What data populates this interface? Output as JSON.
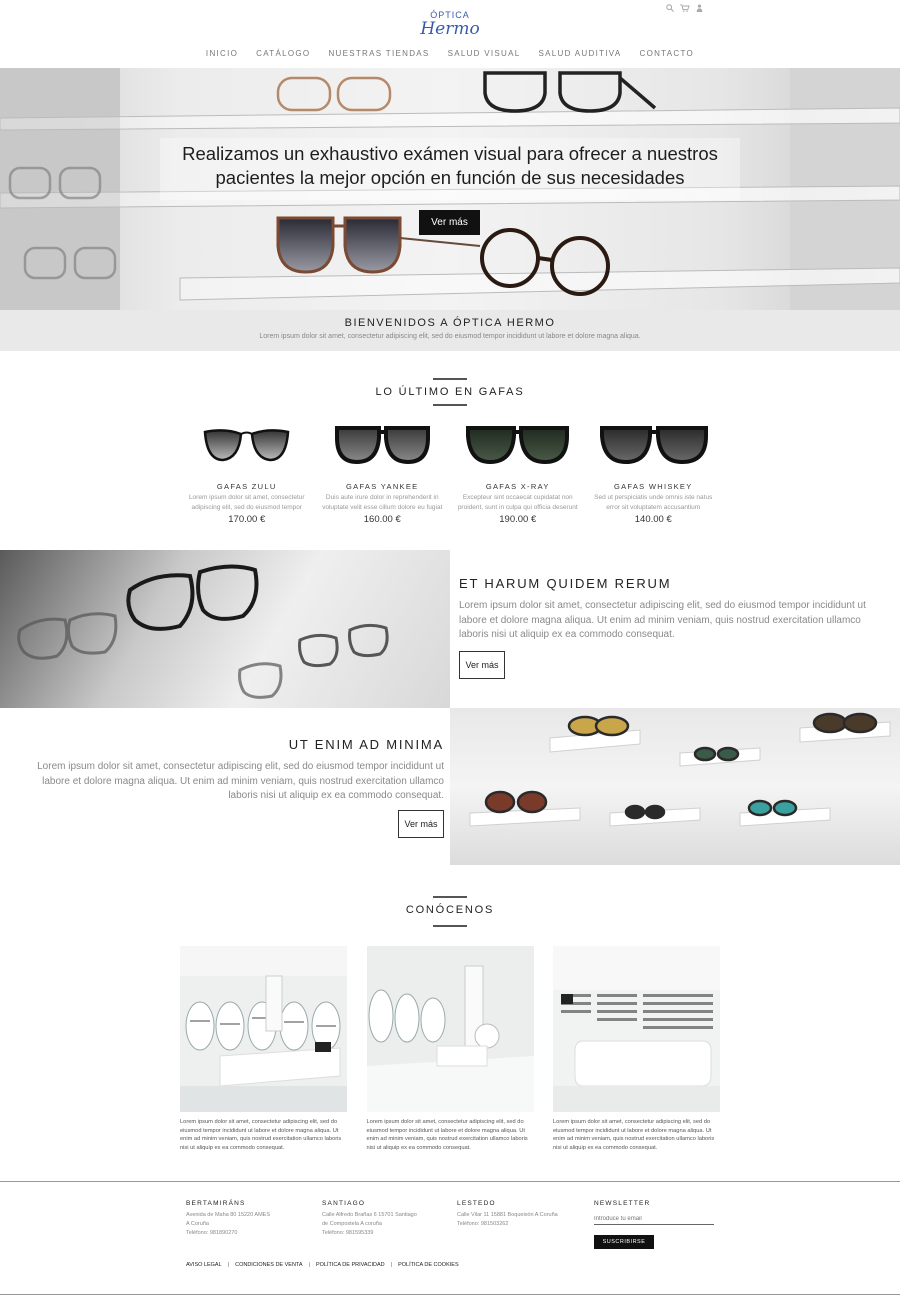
{
  "brand": {
    "logo_top": "ÓPTICA",
    "logo_bottom": "Hermo"
  },
  "utility": {
    "search_icon": "search-icon",
    "cart_icon": "cart-icon",
    "user_icon": "user-icon"
  },
  "nav": {
    "items": [
      "INICIO",
      "CATÁLOGO",
      "NUESTRAS TIENDAS",
      "SALUD VISUAL",
      "SALUD AUDITIVA",
      "CONTACTO"
    ]
  },
  "hero": {
    "line1": "Realizamos un exhaustivo exámen visual para ofrecer a nuestros",
    "line2": "pacientes la mejor opción en función de sus necesidades",
    "button": "Ver más"
  },
  "welcome": {
    "title": "BIENVENIDOS A ÓPTICA HERMO",
    "text": "Lorem ipsum dolor sit amet, consectetur adipiscing elit, sed do eiusmod tempor incididunt ut labore et dolore magna aliqua."
  },
  "latest": {
    "title": "LO ÚLTIMO EN GAFAS",
    "products": [
      {
        "name": "GAFAS ZULU",
        "desc": "Lorem ipsum dolor sit amet, consectetur adipiscing elit, sed do eiusmod tempor",
        "price": "170.00 €"
      },
      {
        "name": "GAFAS YANKEE",
        "desc": "Duis aute irure dolor in reprehenderit in voluptate velit esse cillum dolore eu fugiat",
        "price": "160.00 €"
      },
      {
        "name": "GAFAS X-RAY",
        "desc": "Excepteur sint occaecat cupidatat non proident, sunt in culpa qui officia deserunt",
        "price": "190.00 €"
      },
      {
        "name": "GAFAS WHISKEY",
        "desc": "Sed ut perspiciatis unde omnis iste natus error sit voluptatem accusantium",
        "price": "140.00 €"
      }
    ]
  },
  "feature1": {
    "title": "ET HARUM QUIDEM RERUM",
    "text": "Lorem ipsum dolor sit amet, consectetur adipiscing elit, sed do eiusmod tempor incididunt ut labore et dolore magna aliqua. Ut enim ad minim veniam, quis nostrud exercitation ullamco laboris nisi ut aliquip ex ea commodo consequat.",
    "button": "Ver más"
  },
  "feature2": {
    "title": "UT ENIM AD MINIMA",
    "text": "Lorem ipsum dolor sit amet, consectetur adipiscing elit, sed do eiusmod tempor incididunt ut labore et dolore magna aliqua. Ut enim ad minim veniam, quis nostrud exercitation ullamco laboris nisi ut aliquip ex ea commodo consequat.",
    "button": "Ver más"
  },
  "about": {
    "title": "CONÓCENOS",
    "stores": [
      {
        "text": "Lorem ipsum dolor sit amet, consectetur adipiscing elit, sed do eiusmod tempor incididunt ut labore et dolore magna aliqua. Ut enim ad minim veniam, quis nostrud exercitation ullamco laboris nisi ut aliquip ex ea commodo consequat."
      },
      {
        "text": "Lorem ipsum dolor sit amet, consectetur adipiscing elit, sed do eiusmod tempor incididunt ut labore et dolore magna aliqua. Ut enim ad minim veniam, quis nostrud exercitation ullamco laboris nisi ut aliquip ex ea commodo consequat."
      },
      {
        "text": "Lorem ipsum dolor sit amet, consectetur adipiscing elit, sed do eiusmod tempor incididunt ut labore et dolore magna aliqua. Ut enim ad minim veniam, quis nostrud exercitation ullamco laboris nisi ut aliquip ex ea commodo consequat."
      }
    ]
  },
  "footer": {
    "cols": [
      {
        "title": "BERTAMIRÁNS",
        "lines": [
          "Avenida de Maha 80 15220 AMES",
          "A Coruña",
          "Teléfono: 981890270"
        ]
      },
      {
        "title": "SANTIAGO",
        "lines": [
          "Calle Alfredo Brañas 6 15701 Santiago",
          "de Compostela A coruña",
          "Teléfono: 981595339"
        ]
      },
      {
        "title": "LESTEDO",
        "lines": [
          "Calle Vilar 11 15881 Boqueixón A Coruña",
          "Teléfono: 981503262"
        ]
      }
    ],
    "newsletter": {
      "title": "NEWSLETTER",
      "placeholder": "Introduce tu email",
      "button": "SUSCRIBIRSE"
    },
    "legal": [
      "AVISO LEGAL",
      "CONDICIONES DE VENTA",
      "POLÍTICA DE PRIVACIDAD",
      "POLÍTICA DE COOKIES"
    ],
    "separator": "|"
  }
}
